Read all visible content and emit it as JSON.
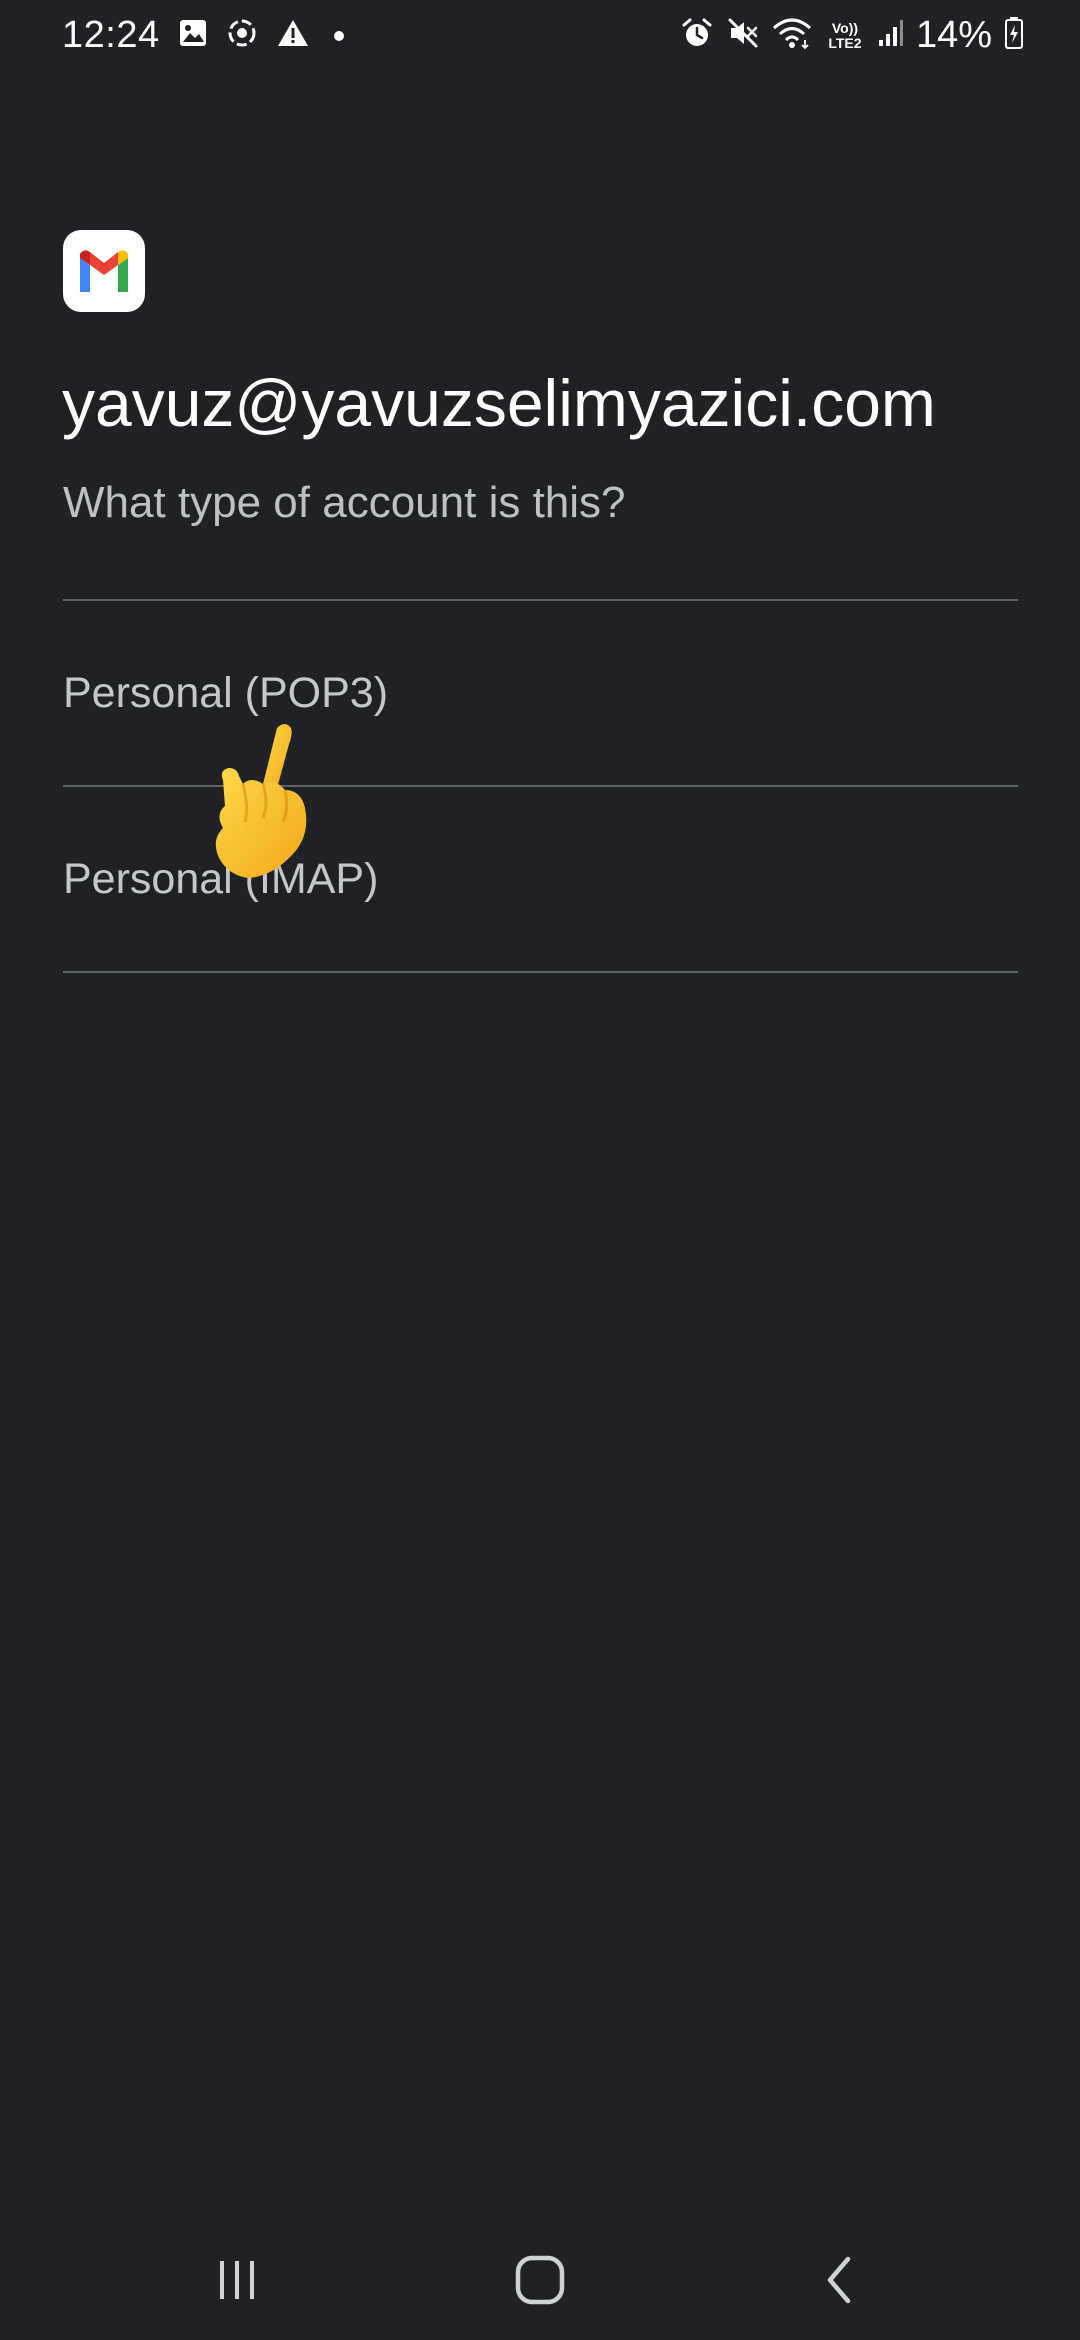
{
  "status_bar": {
    "time": "12:24",
    "battery": "14%",
    "network_top": "Vo))",
    "network_bottom": "LTE2",
    "left_icons": [
      "image-icon",
      "screen-record-icon",
      "warning-icon",
      "dot-icon"
    ],
    "right_icons": [
      "alarm-icon",
      "mute-icon",
      "wifi-icon",
      "lte-icon",
      "signal-icon",
      "battery-icon"
    ]
  },
  "header": {
    "app_logo": "gmail-logo",
    "email": "yavuz@yavuzselimyazici.com",
    "question": "What type of account is this?"
  },
  "options": [
    {
      "label": "Personal (POP3)"
    },
    {
      "label": "Personal (IMAP)"
    }
  ],
  "overlay": {
    "icon": "pointing-hand-icon"
  },
  "nav_bar": {
    "buttons": [
      "recents-icon",
      "home-icon",
      "back-icon"
    ]
  },
  "colors": {
    "background": "#202124",
    "text_primary": "#ffffff",
    "text_secondary": "#bdc1c6",
    "divider": "#5f6368",
    "gmail_red": "#EA4335",
    "gmail_blue": "#4285F4",
    "gmail_green": "#34A853",
    "gmail_yellow": "#FBBC04"
  }
}
